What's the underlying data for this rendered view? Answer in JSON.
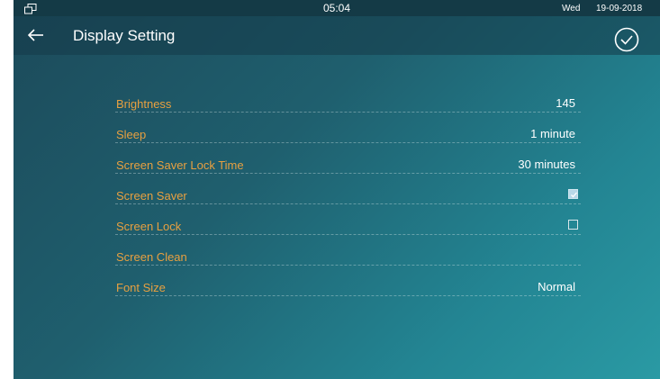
{
  "status_bar": {
    "time": "05:04",
    "day": "Wed",
    "date": "19-09-2018"
  },
  "header": {
    "title": "Display Setting"
  },
  "settings": {
    "brightness": {
      "label": "Brightness",
      "value": "145"
    },
    "sleep": {
      "label": "Sleep",
      "value": "1 minute"
    },
    "screen_saver_lock_time": {
      "label": "Screen Saver Lock Time",
      "value": "30 minutes"
    },
    "screen_saver": {
      "label": "Screen Saver",
      "checked": true
    },
    "screen_lock": {
      "label": "Screen Lock",
      "checked": false
    },
    "screen_clean": {
      "label": "Screen Clean"
    },
    "font_size": {
      "label": "Font Size",
      "value": "Normal"
    }
  },
  "colors": {
    "label": "#e8a040",
    "value": "#ffffff",
    "status_bar": "#143a46",
    "background_start": "#1c4a5a",
    "background_end": "#2a9aa4"
  },
  "icons": {
    "status_left": "window-restore-icon",
    "back": "arrow-left-icon",
    "confirm": "check-circle-icon",
    "checkbox_on": "checkbox-checked-icon",
    "checkbox_off": "checkbox-empty-icon"
  }
}
